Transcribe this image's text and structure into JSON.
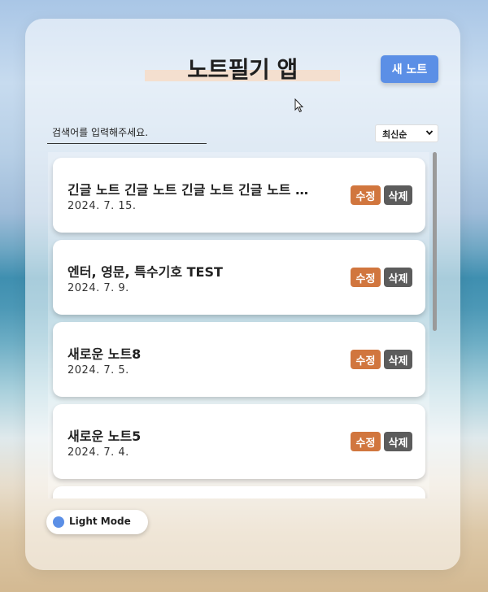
{
  "app": {
    "title": "노트필기 앱",
    "new_note_label": "새 노트",
    "accent_color": "#5b8fe6"
  },
  "search": {
    "placeholder": "검색어를 입력해주세요.",
    "value": ""
  },
  "sort": {
    "selected": "최신순"
  },
  "notes": [
    {
      "title": "긴글 노트 긴글 노트 긴글 노트 긴글 노트 긴글 노트",
      "date": "2024. 7. 15.",
      "edit_label": "수정",
      "delete_label": "삭제"
    },
    {
      "title": "엔터, 영문, 특수기호 TEST",
      "date": "2024. 7. 9.",
      "edit_label": "수정",
      "delete_label": "삭제"
    },
    {
      "title": "새로운 노트8",
      "date": "2024. 7. 5.",
      "edit_label": "수정",
      "delete_label": "삭제"
    },
    {
      "title": "새로운 노트5",
      "date": "2024. 7. 4.",
      "edit_label": "수정",
      "delete_label": "삭제"
    },
    {
      "title": "",
      "date": "",
      "edit_label": "",
      "delete_label": ""
    }
  ],
  "theme": {
    "label": "Light Mode"
  },
  "colors": {
    "edit": "#d1763e",
    "delete": "#5c5c5c",
    "highlight": "#f4dfcf"
  }
}
